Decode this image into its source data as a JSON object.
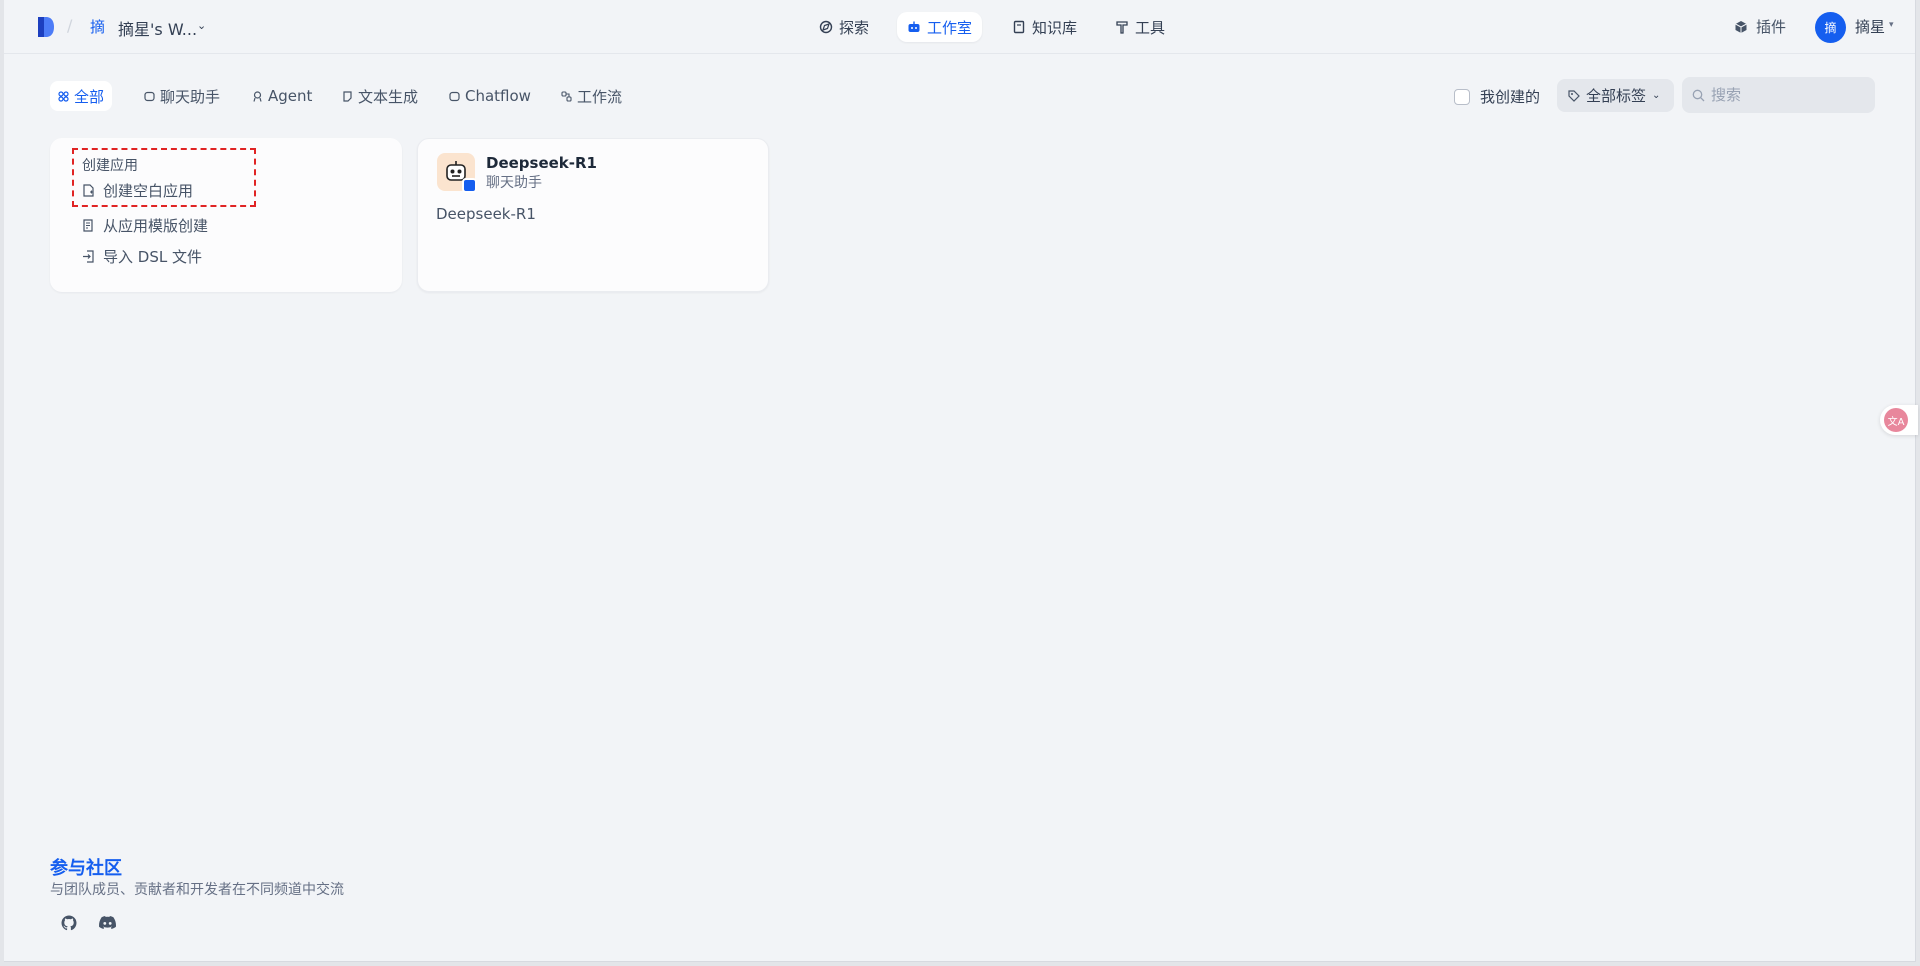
{
  "header": {
    "workspace_initial": "摘",
    "workspace_name": "摘星's W...",
    "nav": {
      "explore": "探索",
      "studio": "工作室",
      "knowledge": "知识库",
      "tools": "工具"
    },
    "plugins": "插件",
    "user_initial": "摘",
    "user_name": "摘星"
  },
  "filters": {
    "tabs": [
      "全部",
      "聊天助手",
      "Agent",
      "文本生成",
      "Chatflow",
      "工作流"
    ],
    "mine_label": "我创建的",
    "tags_label": "全部标签",
    "search_placeholder": "搜索"
  },
  "create_card": {
    "title": "创建应用",
    "items": [
      "创建空白应用",
      "从应用模版创建",
      "导入 DSL 文件"
    ]
  },
  "apps": [
    {
      "name": "Deepseek-R1",
      "type": "聊天助手",
      "description": "Deepseek-R1"
    }
  ],
  "footer": {
    "title": "参与社区",
    "subtitle": "与团队成员、贡献者和开发者在不同频道中交流",
    "links": [
      "github-icon",
      "discord-icon"
    ]
  },
  "floating": {
    "label": "文A"
  },
  "colors": {
    "accent": "#155eef",
    "highlight": "#e02424",
    "background": "#f2f4f7"
  }
}
